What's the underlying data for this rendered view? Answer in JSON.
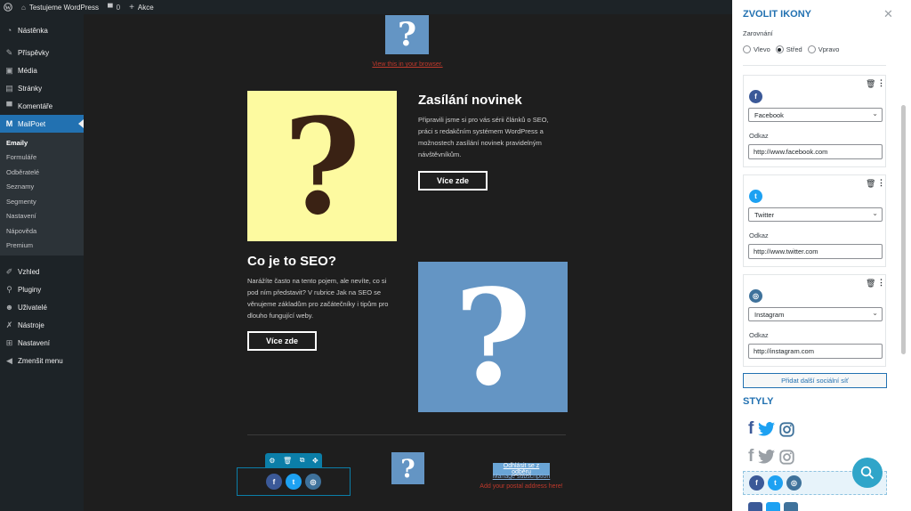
{
  "adminbar": {
    "site": "Testujeme WordPress",
    "comments": "0",
    "new": "Akce"
  },
  "sidebar": {
    "items_top": [
      {
        "label": "Nástěnka",
        "icon": "dashboard-icon"
      },
      {
        "label": "Příspěvky",
        "icon": "pin-icon"
      },
      {
        "label": "Média",
        "icon": "media-icon"
      },
      {
        "label": "Stránky",
        "icon": "pages-icon"
      },
      {
        "label": "Komentáře",
        "icon": "comments-icon"
      }
    ],
    "active": {
      "label": "MailPoet",
      "icon": "mailpoet-icon"
    },
    "submenu": [
      "Emaily",
      "Formuláře",
      "Odběratelé",
      "Seznamy",
      "Segmenty",
      "Nastavení",
      "Nápověda",
      "Premium"
    ],
    "items_bottom": [
      {
        "label": "Vzhled",
        "icon": "brush-icon"
      },
      {
        "label": "Pluginy",
        "icon": "plugin-icon"
      },
      {
        "label": "Uživatelé",
        "icon": "users-icon"
      },
      {
        "label": "Nástroje",
        "icon": "wrench-icon"
      },
      {
        "label": "Nastavení",
        "icon": "settings-icon"
      },
      {
        "label": "Zmenšit menu",
        "icon": "collapse-icon"
      }
    ]
  },
  "email": {
    "view_browser": "View this in your browser.",
    "block1": {
      "title": "Zasílání novinek",
      "text": "Připravili jsme si pro vás sérii článků o SEO, práci s redakčním systémem WordPress a možnostech zasílání novinek pravidelným návštěvníkům.",
      "button": "Více zde"
    },
    "block2": {
      "title": "Co je to SEO?",
      "text": "Narážíte často na tento pojem, ale nevíte, co si pod ním představit? V rubrice Jak na SEO se věnujeme základům pro začátečníky i tipům pro dlouho fungující weby.",
      "button": "Více zde"
    },
    "placeholder_glyph": "?",
    "footer": {
      "unsubscribe": "Odhlásit se z odběru",
      "manage": "Manage subscription",
      "address": "Add your postal address here!"
    }
  },
  "panel": {
    "title": "ZVOLIT IKONY",
    "align_label": "Zarovnání",
    "align_options": [
      "Vlevo",
      "Střed",
      "Vpravo"
    ],
    "align_selected": "Střed",
    "networks": [
      {
        "name": "Facebook",
        "link_label": "Odkaz",
        "url": "http://www.facebook.com",
        "color": "#3b5998",
        "glyph": "f"
      },
      {
        "name": "Twitter",
        "link_label": "Odkaz",
        "url": "http://www.twitter.com",
        "color": "#1da1f2",
        "glyph": "t"
      },
      {
        "name": "Instagram",
        "link_label": "Odkaz",
        "url": "http://instagram.com",
        "color": "#3f729b",
        "glyph": "◎"
      }
    ],
    "add_button": "Přidat další sociální síť",
    "styles_title": "STYLY"
  },
  "colors": {
    "accent": "#2271b1",
    "sidebar": "#1d2327",
    "canvas": "#1e1e1e",
    "yellow": "#fdfaa0",
    "blue_ph": "#6495c4",
    "search": "#30a5c9"
  }
}
